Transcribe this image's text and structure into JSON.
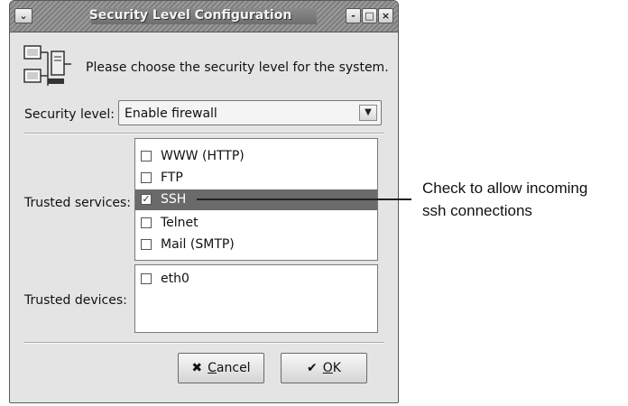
{
  "window": {
    "title": "Security Level Configuration",
    "controls": {
      "minimize": "-",
      "maximize": "□",
      "close": "×",
      "menu": "⌄"
    }
  },
  "header": {
    "text": "Please choose the security level for the system.",
    "icon": "computer-network-icon"
  },
  "security_level": {
    "label": "Security level:",
    "selected": "Enable firewall",
    "dropdown_icon": "chevron-down-icon"
  },
  "trusted_services": {
    "label": "Trusted services:",
    "items": [
      {
        "label": "WWW (HTTP)",
        "checked": false,
        "selected": false
      },
      {
        "label": "FTP",
        "checked": false,
        "selected": false
      },
      {
        "label": "SSH",
        "checked": true,
        "selected": true
      },
      {
        "label": "Telnet",
        "checked": false,
        "selected": false
      },
      {
        "label": "Mail (SMTP)",
        "checked": false,
        "selected": false
      }
    ]
  },
  "trusted_devices": {
    "label": "Trusted devices:",
    "items": [
      {
        "label": "eth0",
        "checked": false
      }
    ]
  },
  "buttons": {
    "cancel": {
      "label": "Cancel",
      "mnemonic": "C",
      "rest": "ancel",
      "icon": "cancel-x-icon"
    },
    "ok": {
      "label": "OK",
      "mnemonic": "O",
      "rest": "K",
      "icon": "checkmark-icon"
    }
  },
  "annotation": {
    "line1": "Check to allow incoming",
    "line2": "ssh connections"
  },
  "colors": {
    "window_bg": "#e4e4e4",
    "selection": "#6a6a6a",
    "titlebar": "#8a8a8a"
  }
}
